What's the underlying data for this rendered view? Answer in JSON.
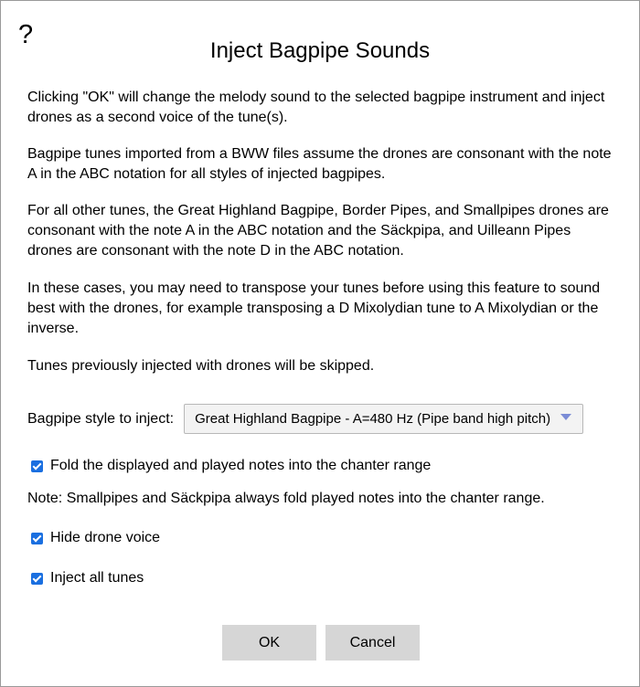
{
  "dialog": {
    "help_symbol": "?",
    "title": "Inject Bagpipe Sounds",
    "paragraphs": [
      "Clicking \"OK\" will change the melody sound to the selected bagpipe instrument and inject drones as a second voice of the tune(s).",
      "Bagpipe tunes imported from a BWW files assume the drones are consonant with the note A in the ABC notation for all styles of injected bagpipes.",
      "For all other tunes, the Great Highland Bagpipe, Border Pipes, and Smallpipes drones are consonant with the note A in the ABC notation and the Säckpipa, and Uilleann Pipes drones are consonant with the note D in the ABC notation.",
      "In these cases, you may need to transpose your tunes before using this feature to sound best with the drones, for example transposing a D Mixolydian tune to A Mixolydian or the inverse.",
      "Tunes previously injected with drones will be skipped."
    ],
    "style_label": "Bagpipe style to inject:",
    "style_selected": "Great Highland Bagpipe - A=480 Hz (Pipe band high pitch)",
    "fold_label": "Fold the displayed and played notes into the chanter range",
    "fold_checked": true,
    "note": "Note: Smallpipes and Säckpipa always fold played notes into the chanter range.",
    "hide_drone_label": "Hide drone voice",
    "hide_drone_checked": true,
    "inject_all_label": "Inject all tunes",
    "inject_all_checked": true,
    "ok_label": "OK",
    "cancel_label": "Cancel"
  },
  "colors": {
    "checkbox": "#1a6fe0",
    "button_bg": "#d6d6d6",
    "select_caret": "#7b8cd6"
  }
}
